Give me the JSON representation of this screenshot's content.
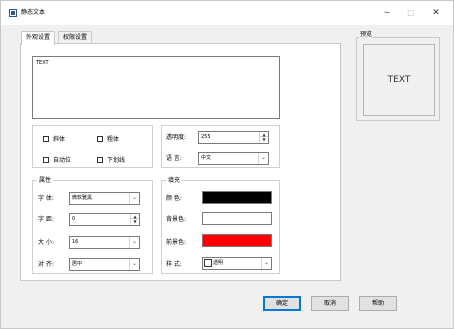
{
  "window": {
    "title": "静态文本",
    "minimize_glyph": "─",
    "maximize_glyph": "□",
    "close_glyph": "✕",
    "icon": "app-icon"
  },
  "tabs": [
    {
      "label": "外观设置",
      "active": true
    },
    {
      "label": "权限设置",
      "active": false
    }
  ],
  "text_content": "TEXT",
  "checkboxes": {
    "italic": {
      "label": "斜体",
      "checked": false
    },
    "bold": {
      "label": "粗体",
      "checked": false
    },
    "auto_wrap": {
      "label": "自动位",
      "checked": false
    },
    "underline": {
      "label": "下划线",
      "checked": false
    }
  },
  "opacity": {
    "label": "透明度:",
    "value": "255"
  },
  "language": {
    "label": "语  言:",
    "value": "中文"
  },
  "attributes": {
    "title": "属性",
    "font": {
      "label": "字  体:",
      "value": "微软雅黑"
    },
    "spacing": {
      "label": "字  距:",
      "value": "0"
    },
    "size": {
      "label": "大  小:",
      "value": "16"
    },
    "align": {
      "label": "对  齐:",
      "value": "居中"
    }
  },
  "fill": {
    "title": "填充",
    "color": {
      "label": "颜  色:",
      "value": "#000000"
    },
    "background": {
      "label": "背景色:",
      "value": "#ffffff"
    },
    "foreground": {
      "label": "前景色:",
      "value": "#ff0000"
    },
    "style": {
      "label": "样  式:",
      "value": "透明"
    }
  },
  "preview": {
    "title": "预览",
    "text": "TEXT"
  },
  "buttons": {
    "ok": "确定",
    "cancel": "取消",
    "help": "帮助"
  },
  "icons": {
    "combo_arrow": "chevron-down-icon",
    "spin": "spin-arrows-icon"
  }
}
